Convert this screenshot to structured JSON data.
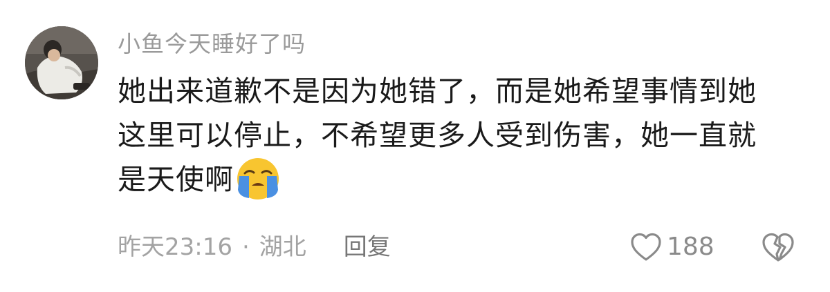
{
  "comment": {
    "username": "小鱼今天睡好了吗",
    "content_lines": [
      "她出来道歉不是因为她错了，而是她希望事情到她",
      "这里可以停止，不希望更多人受到伤害，她一直就",
      "是天使啊"
    ],
    "emoji": "loudly-crying-face",
    "time": "昨天23:16",
    "separator": "·",
    "location": "湖北",
    "reply_label": "回复",
    "like_count": "188"
  },
  "icons": {
    "like": "heart-outline-icon",
    "dislike": "broken-heart-outline-icon"
  },
  "colors": {
    "username": "#9a9a9a",
    "text": "#1a1a1a",
    "meta": "#a3a3a3",
    "emoji_face": "#f8c530",
    "emoji_tears": "#4a90e2"
  }
}
